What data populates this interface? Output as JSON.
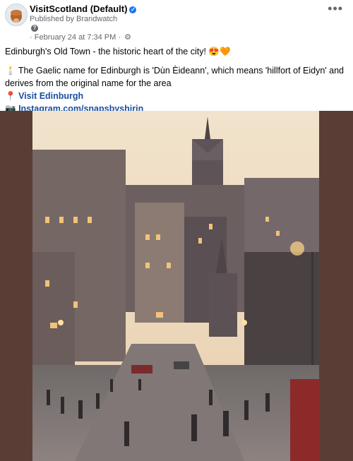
{
  "post": {
    "page_name": "VisitScotland (Default)",
    "verified_icon": "verified-badge-icon",
    "byline": "Published by Brandwatch",
    "date": "February 24 at 7:34 PM",
    "audience_icon": "gear-icon",
    "more_icon": "more-options-icon",
    "headline": "Edinburgh's Old Town - the historic heart of the city! 😍🧡",
    "gaelic_text": "The Gaelic name for Edinburgh is 'Dùn Èideann', which means 'hillfort of Eidyn' and derives from the original name for the area",
    "link1_label": "Visit Edinburgh",
    "link2_label": "Instagram.com/snapsbyshirin"
  },
  "colors": {
    "link": "#1a4fa0",
    "frame": "#5a3e35",
    "accent": "#1877f2"
  }
}
